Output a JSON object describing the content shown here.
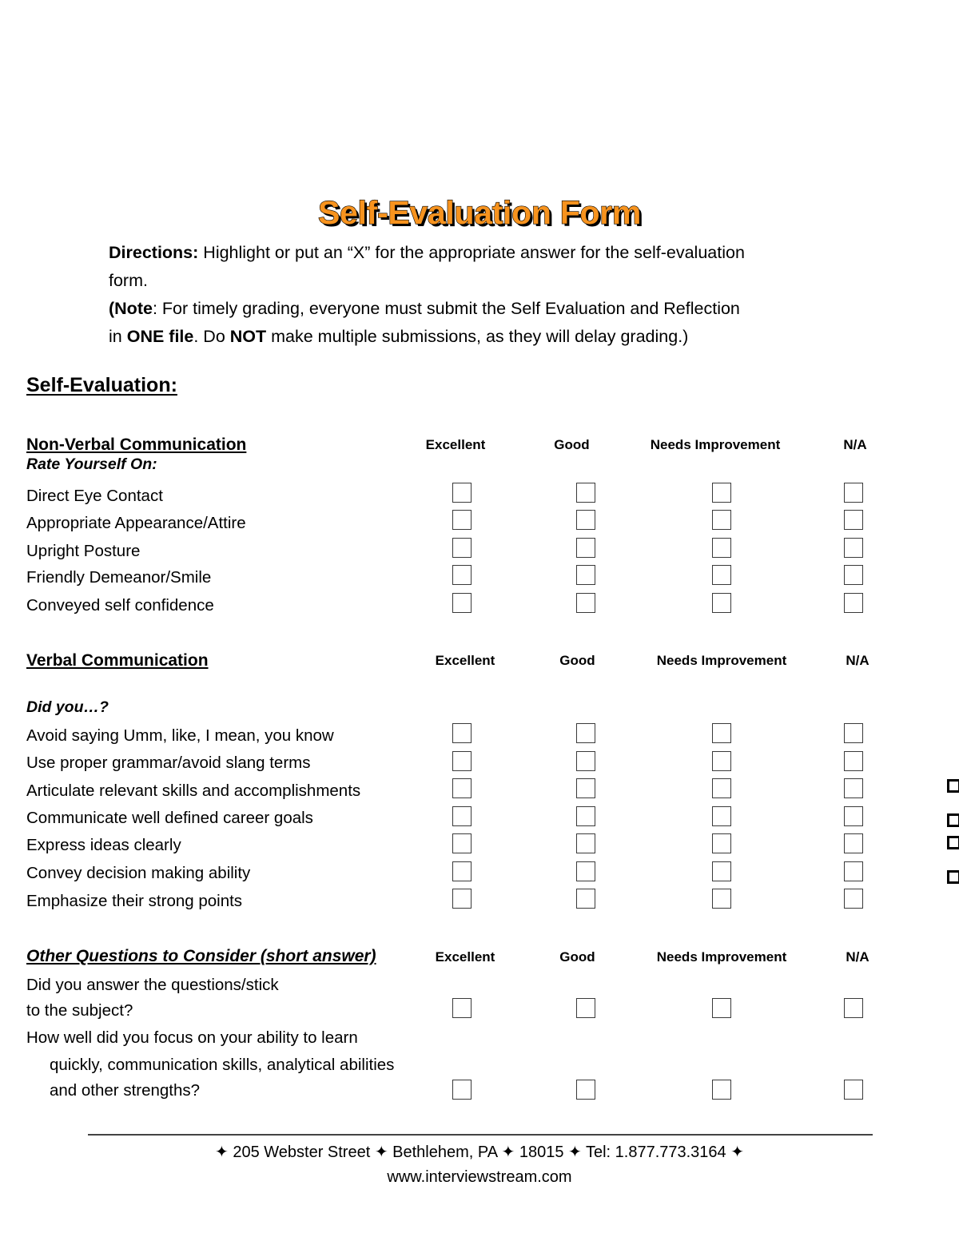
{
  "document": {
    "title": "Self-Evaluation Form",
    "title_color": "#F7931E",
    "directions": {
      "label": "Directions:",
      "line1_rest": " Highlight or put an “X” for the appropriate answer for the self-evaluation",
      "line2": "form.",
      "note_open": "(Note",
      "note_line1_rest": ": For timely grading, everyone must submit the Self Evaluation and Reflection",
      "note_line2_a": "in ",
      "note_line2_b": "ONE file",
      "note_line2_c": ". Do ",
      "note_line2_d": "NOT",
      "note_line2_e": " make multiple submissions, as they will delay grading.)"
    },
    "main_heading": "Self-Evaluation:"
  },
  "rating_columns": [
    "Excellent",
    "Good",
    "Needs Improvement",
    "N/A"
  ],
  "sections": [
    {
      "id": "non-verbal-communication",
      "title": "Non-Verbal Communication",
      "title_style": "bold-underline",
      "sub_label": "Rate Yourself On:",
      "items": [
        "Direct Eye Contact",
        "Appropriate Appearance/Attire",
        "Upright Posture",
        "Friendly Demeanor/Smile",
        "Conveyed self confidence"
      ]
    },
    {
      "id": "verbal-communication",
      "title": "Verbal Communication",
      "title_style": "bold-underline",
      "sub_label": "Did you…?",
      "items": [
        "Avoid saying Umm, like, I mean, you know",
        "Use proper grammar/avoid slang terms",
        "Articulate relevant skills and accomplishments",
        "Communicate well defined career goals",
        "Express ideas clearly",
        "Convey decision making ability",
        "Emphasize their strong points"
      ]
    },
    {
      "id": "other-questions",
      "title": "Other Questions to Consider (short answer)",
      "title_style": "bold-italic-underline",
      "sub_label": "",
      "items": [
        "Did you answer the questions/stick",
        "to the subject?",
        "How well did you focus on your ability to learn",
        "quickly, communication skills, analytical abilities",
        "and other strengths?"
      ]
    }
  ],
  "footer": {
    "bullet": "✦",
    "line1": "✦ 205 Webster Street ✦ Bethlehem, PA ✦ 18015 ✦ Tel: 1.877.773.3164 ✦",
    "line2": "www.interviewstream.com"
  }
}
